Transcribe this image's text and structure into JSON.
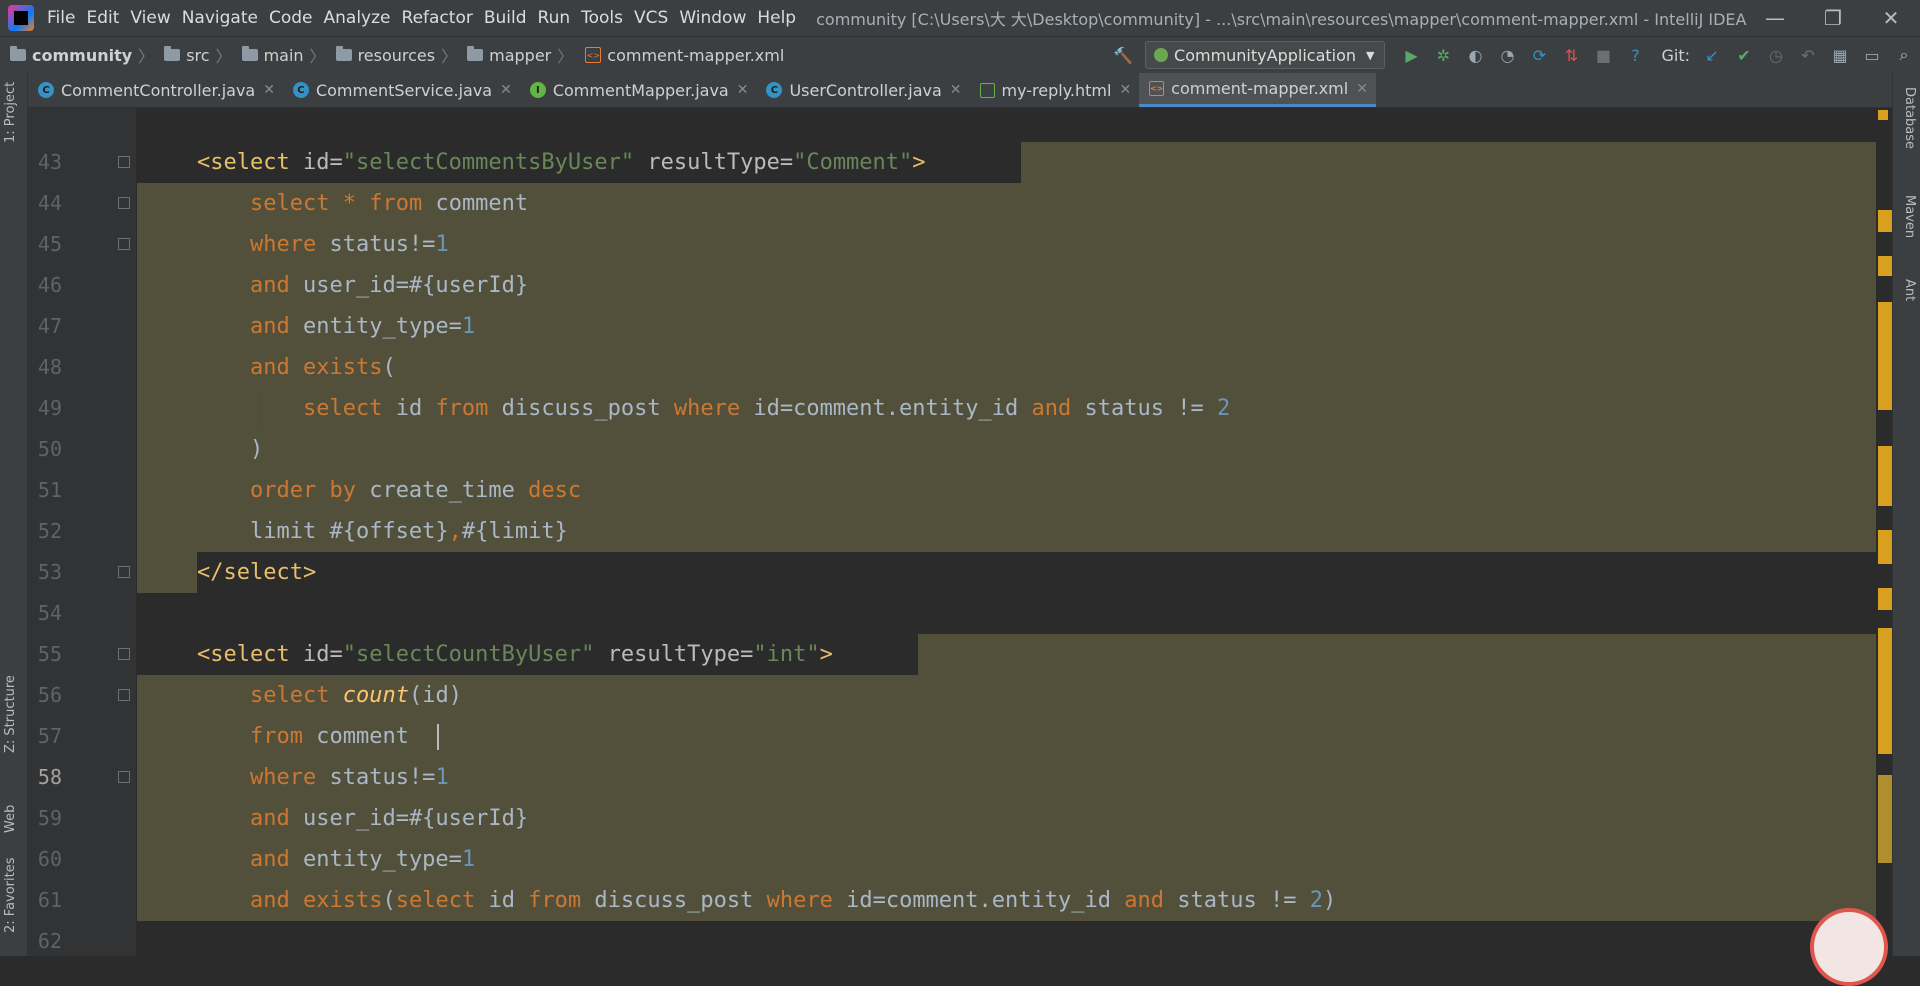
{
  "menu": {
    "items": [
      "File",
      "Edit",
      "View",
      "Navigate",
      "Code",
      "Analyze",
      "Refactor",
      "Build",
      "Run",
      "Tools",
      "VCS",
      "Window",
      "Help"
    ],
    "window_title": "community [C:\\Users\\大 大\\Desktop\\community] - ...\\src\\main\\resources\\mapper\\comment-mapper.xml - IntelliJ IDEA"
  },
  "window_controls": {
    "minimize": "—",
    "restore": "❐",
    "close": "✕"
  },
  "breadcrumbs": [
    "community",
    "src",
    "main",
    "resources",
    "mapper",
    "comment-mapper.xml"
  ],
  "toolbar": {
    "run_config": "CommunityApplication",
    "git_label": "Git:"
  },
  "tabs": [
    {
      "label": "CommentController.java",
      "icon": "class-icon",
      "active": false
    },
    {
      "label": "CommentService.java",
      "icon": "class-icon",
      "active": false
    },
    {
      "label": "CommentMapper.java",
      "icon": "interface-icon",
      "active": false
    },
    {
      "label": "UserController.java",
      "icon": "class-icon",
      "active": false
    },
    {
      "label": "my-reply.html",
      "icon": "html-icon",
      "active": false
    },
    {
      "label": "comment-mapper.xml",
      "icon": "xml-icon",
      "active": true
    }
  ],
  "left_tool_windows": [
    "1: Project",
    "Z: Structure",
    "Web",
    "2: Favorites"
  ],
  "right_tool_windows": [
    "Database",
    "Maven",
    "Ant"
  ],
  "editor": {
    "current_line": 58,
    "line_numbers": [
      "43",
      "44",
      "45",
      "46",
      "47",
      "48",
      "49",
      "50",
      "51",
      "52",
      "53",
      "54",
      "55",
      "56",
      "57",
      "58",
      "59",
      "60",
      "61",
      "62"
    ]
  },
  "colors": {
    "background": "#2b2b2b",
    "selection_highlight": "#52503a",
    "keyword": "#cc7832",
    "tag": "#e8bf6a",
    "string": "#6a8759",
    "number": "#6897bb",
    "text": "#a9b7c6",
    "accent_tab": "#4a88c7",
    "marker": "#d9a020"
  }
}
